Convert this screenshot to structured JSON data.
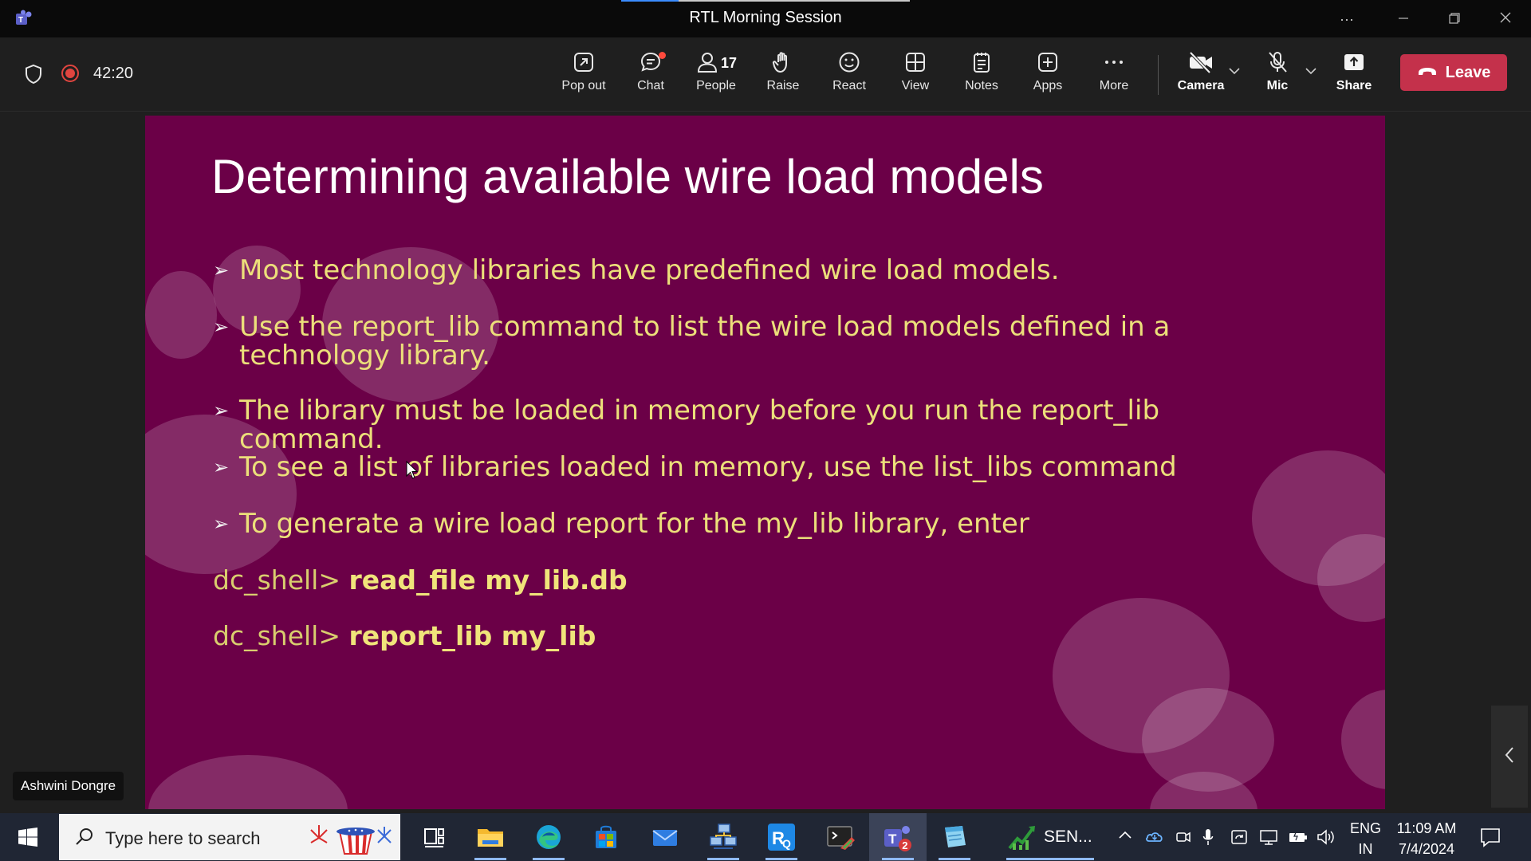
{
  "window": {
    "title": "RTL Morning Session",
    "controls": [
      "...",
      "minimize",
      "restore",
      "close"
    ]
  },
  "meeting": {
    "timer": "42:20",
    "recording": true,
    "toolbar": [
      {
        "key": "popout",
        "label": "Pop out",
        "icon": "pop-out-icon"
      },
      {
        "key": "chat",
        "label": "Chat",
        "icon": "chat-icon",
        "has_unread": true
      },
      {
        "key": "people",
        "label": "People",
        "icon": "people-icon",
        "count": "17"
      },
      {
        "key": "raise",
        "label": "Raise",
        "icon": "raise-hand-icon"
      },
      {
        "key": "react",
        "label": "React",
        "icon": "smiley-icon"
      },
      {
        "key": "view",
        "label": "View",
        "icon": "grid-icon"
      },
      {
        "key": "notes",
        "label": "Notes",
        "icon": "notes-icon"
      },
      {
        "key": "apps",
        "label": "Apps",
        "icon": "plus-icon"
      },
      {
        "key": "more",
        "label": "More",
        "icon": "more-icon"
      },
      {
        "key": "camera",
        "label": "Camera",
        "icon": "camera-off-icon"
      },
      {
        "key": "mic",
        "label": "Mic",
        "icon": "mic-off-icon"
      },
      {
        "key": "share",
        "label": "Share",
        "icon": "share-icon"
      }
    ],
    "leave_label": "Leave",
    "presenter": "Ashwini Dongre"
  },
  "slide": {
    "title": "Determining available wire load models",
    "bullets": [
      "Most technology libraries have predefined wire load models.",
      "Use the report_lib command to list the wire load models defined in a technology library.",
      "The library must be loaded in memory before you run the report_lib command.",
      "To see a list of libraries loaded in memory, use the list_libs command",
      "To generate a wire load report for the my_lib library, enter"
    ],
    "commands": [
      {
        "prompt": "dc_shell>",
        "command": "read_file my_lib.db"
      },
      {
        "prompt": "dc_shell>",
        "command": "report_lib my_lib"
      }
    ],
    "colors": {
      "background": "#6b0047",
      "bullet_text": "#ecdf7a",
      "title": "#ffffff"
    }
  },
  "taskbar": {
    "search_placeholder": "Type here to search",
    "pinned": [
      "task-view-icon",
      "file-explorer-icon",
      "edge-icon",
      "store-icon",
      "mail-icon",
      "network-app-icon",
      "rq-app-icon",
      "terminal-app-icon",
      "teams-icon",
      "notepad-app-icon",
      "sen-chart-app-icon"
    ],
    "teams_badge": "2",
    "sen_label": "SEN...",
    "language": {
      "line1": "ENG",
      "line2": "IN"
    },
    "time": "11:09 AM",
    "date": "7/4/2024"
  }
}
